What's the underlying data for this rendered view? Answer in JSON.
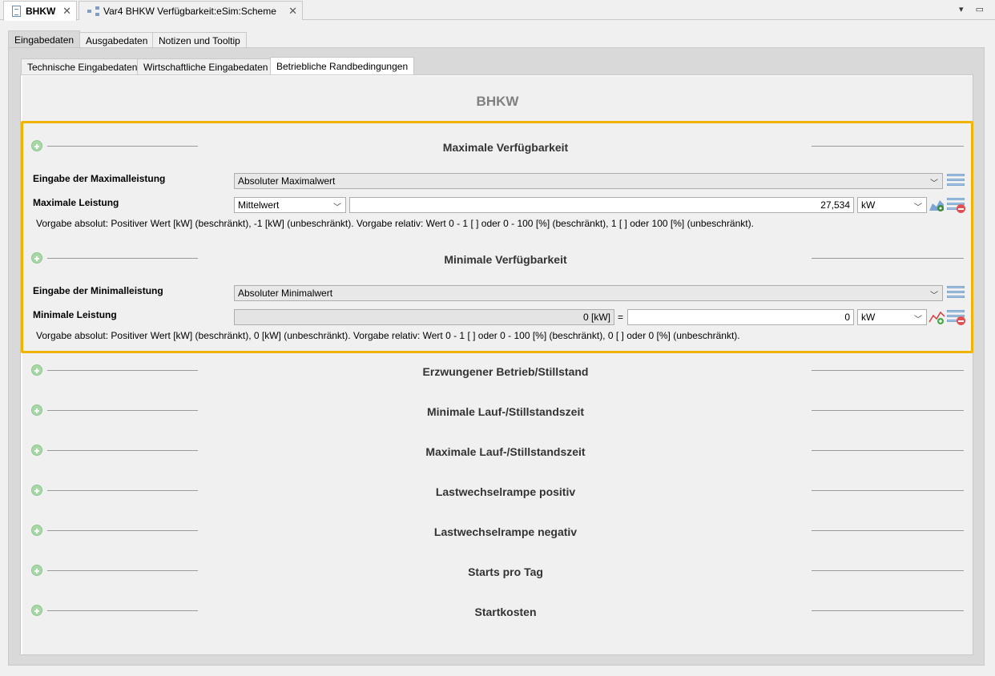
{
  "editor_tabs": [
    {
      "label": "BHKW",
      "close": "✕"
    },
    {
      "label": "Var4 BHKW Verfügbarkeit:eSim:Scheme",
      "close": "✕"
    }
  ],
  "window_controls": "▾ ▭",
  "page_tabs": [
    "Eingabedaten",
    "Ausgabedaten",
    "Notizen und Tooltip"
  ],
  "sub_tabs": [
    "Technische Eingabedaten",
    "Wirtschaftliche Eingabedaten",
    "Betriebliche Randbedingungen"
  ],
  "page_title": "BHKW",
  "max": {
    "section_title": "Maximale Verfügbarkeit",
    "input_label": "Eingabe der Maximalleistung",
    "input_mode": "Absoluter Maximalwert",
    "power_label": "Maximale Leistung",
    "aggregation": "Mittelwert",
    "value": "27,534",
    "unit": "kW",
    "hint": "Vorgabe absolut: Positiver Wert [kW] (beschränkt), -1 [kW] (unbeschränkt). Vorgabe relativ: Wert 0 - 1 [ ] oder 0 - 100 [%] (beschränkt), 1 [ ] oder 100 [%] (unbeschränkt)."
  },
  "min": {
    "section_title": "Minimale Verfügbarkeit",
    "input_label": "Eingabe der Minimalleistung",
    "input_mode": "Absoluter Minimalwert",
    "power_label": "Minimale Leistung",
    "readonly_value": "0 [kW]",
    "equals": "=",
    "value": "0",
    "unit": "kW",
    "hint": "Vorgabe absolut: Positiver Wert [kW] (beschränkt), 0 [kW] (unbeschränkt). Vorgabe relativ: Wert 0 - 1 [ ] oder 0 - 100 [%] (beschränkt), 0 [ ] oder 0 [%] (unbeschränkt)."
  },
  "collapsed_sections": [
    "Erzwungener Betrieb/Stillstand",
    "Minimale Lauf-/Stillstandszeit",
    "Maximale Lauf-/Stillstandszeit",
    "Lastwechselrampe positiv",
    "Lastwechselrampe negativ",
    "Starts pro Tag",
    "Startkosten"
  ],
  "colors": {
    "highlight": "#f0b400",
    "expand_icon": "#a8d8a8"
  }
}
